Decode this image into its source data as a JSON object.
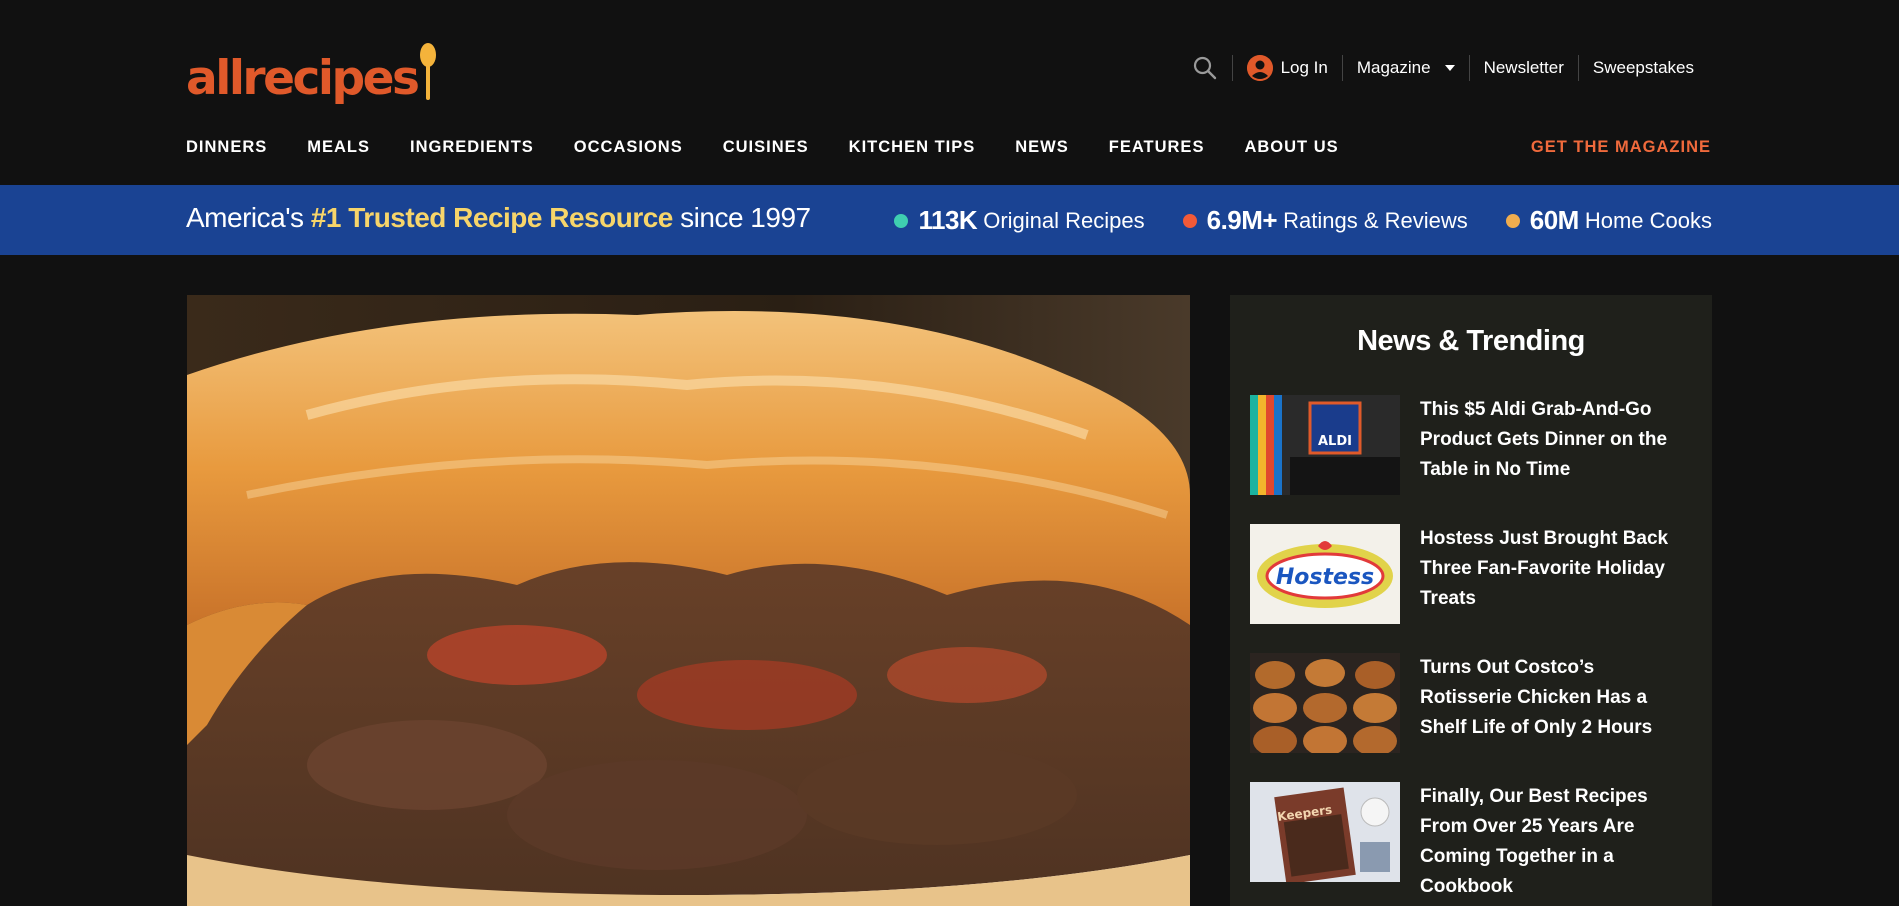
{
  "logo": {
    "text": "allrecipes",
    "colors": {
      "brand": "#e0592a",
      "spoon": "#f4b33b"
    }
  },
  "util_nav": {
    "search_icon": "search-icon",
    "login": "Log In",
    "magazine": "Magazine",
    "newsletter": "Newsletter",
    "sweepstakes": "Sweepstakes"
  },
  "main_nav": [
    "DINNERS",
    "MEALS",
    "INGREDIENTS",
    "OCCASIONS",
    "CUISINES",
    "KITCHEN TIPS",
    "NEWS",
    "FEATURES",
    "ABOUT US"
  ],
  "get_magazine": "GET THE MAGAZINE",
  "banner": {
    "prefix": "America's ",
    "highlight": "#1 Trusted Recipe Resource",
    "suffix": " since 1997",
    "bg_color": "#1a4393",
    "stats": [
      {
        "value": "113K",
        "label": "Original Recipes",
        "color": "#3fcfb0"
      },
      {
        "value": "6.9M+",
        "label": "Ratings & Reviews",
        "color": "#f25a38"
      },
      {
        "value": "60M",
        "label": "Home Cooks",
        "color": "#f0ad4e"
      }
    ]
  },
  "trending": {
    "title": "News & Trending",
    "items": [
      {
        "title": "This $5 Aldi Grab-And-Go Product Gets Dinner on the Table in No Time",
        "thumb": "aldi-store-thumb",
        "thumb_text": "ALDI"
      },
      {
        "title": "Hostess Just Brought Back Three Fan-Favorite Holiday Treats",
        "thumb": "hostess-logo-thumb",
        "thumb_text": "Hostess"
      },
      {
        "title": "Turns Out Costco’s Rotisserie Chicken Has a Shelf Life of Only 2 Hours",
        "thumb": "rotisserie-chicken-thumb"
      },
      {
        "title": "Finally, Our Best Recipes From Over 25 Years Are Coming Together in a Cookbook",
        "thumb": "keepers-cookbook-thumb",
        "thumb_text": "Keepers"
      }
    ]
  }
}
